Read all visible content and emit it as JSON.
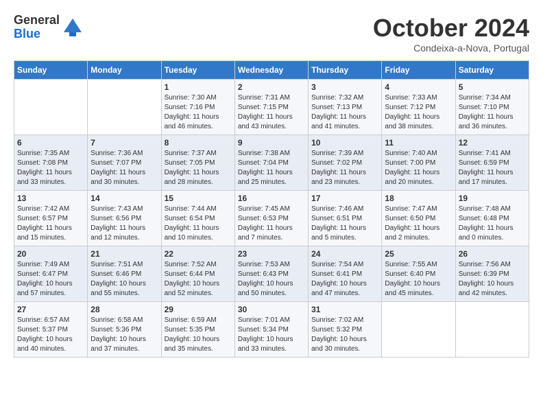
{
  "logo": {
    "general": "General",
    "blue": "Blue"
  },
  "title": "October 2024",
  "subtitle": "Condeixa-a-Nova, Portugal",
  "days_of_week": [
    "Sunday",
    "Monday",
    "Tuesday",
    "Wednesday",
    "Thursday",
    "Friday",
    "Saturday"
  ],
  "weeks": [
    [
      {
        "day": "",
        "info": ""
      },
      {
        "day": "",
        "info": ""
      },
      {
        "day": "1",
        "info": "Sunrise: 7:30 AM\nSunset: 7:16 PM\nDaylight: 11 hours and 46 minutes."
      },
      {
        "day": "2",
        "info": "Sunrise: 7:31 AM\nSunset: 7:15 PM\nDaylight: 11 hours and 43 minutes."
      },
      {
        "day": "3",
        "info": "Sunrise: 7:32 AM\nSunset: 7:13 PM\nDaylight: 11 hours and 41 minutes."
      },
      {
        "day": "4",
        "info": "Sunrise: 7:33 AM\nSunset: 7:12 PM\nDaylight: 11 hours and 38 minutes."
      },
      {
        "day": "5",
        "info": "Sunrise: 7:34 AM\nSunset: 7:10 PM\nDaylight: 11 hours and 36 minutes."
      }
    ],
    [
      {
        "day": "6",
        "info": "Sunrise: 7:35 AM\nSunset: 7:08 PM\nDaylight: 11 hours and 33 minutes."
      },
      {
        "day": "7",
        "info": "Sunrise: 7:36 AM\nSunset: 7:07 PM\nDaylight: 11 hours and 30 minutes."
      },
      {
        "day": "8",
        "info": "Sunrise: 7:37 AM\nSunset: 7:05 PM\nDaylight: 11 hours and 28 minutes."
      },
      {
        "day": "9",
        "info": "Sunrise: 7:38 AM\nSunset: 7:04 PM\nDaylight: 11 hours and 25 minutes."
      },
      {
        "day": "10",
        "info": "Sunrise: 7:39 AM\nSunset: 7:02 PM\nDaylight: 11 hours and 23 minutes."
      },
      {
        "day": "11",
        "info": "Sunrise: 7:40 AM\nSunset: 7:00 PM\nDaylight: 11 hours and 20 minutes."
      },
      {
        "day": "12",
        "info": "Sunrise: 7:41 AM\nSunset: 6:59 PM\nDaylight: 11 hours and 17 minutes."
      }
    ],
    [
      {
        "day": "13",
        "info": "Sunrise: 7:42 AM\nSunset: 6:57 PM\nDaylight: 11 hours and 15 minutes."
      },
      {
        "day": "14",
        "info": "Sunrise: 7:43 AM\nSunset: 6:56 PM\nDaylight: 11 hours and 12 minutes."
      },
      {
        "day": "15",
        "info": "Sunrise: 7:44 AM\nSunset: 6:54 PM\nDaylight: 11 hours and 10 minutes."
      },
      {
        "day": "16",
        "info": "Sunrise: 7:45 AM\nSunset: 6:53 PM\nDaylight: 11 hours and 7 minutes."
      },
      {
        "day": "17",
        "info": "Sunrise: 7:46 AM\nSunset: 6:51 PM\nDaylight: 11 hours and 5 minutes."
      },
      {
        "day": "18",
        "info": "Sunrise: 7:47 AM\nSunset: 6:50 PM\nDaylight: 11 hours and 2 minutes."
      },
      {
        "day": "19",
        "info": "Sunrise: 7:48 AM\nSunset: 6:48 PM\nDaylight: 11 hours and 0 minutes."
      }
    ],
    [
      {
        "day": "20",
        "info": "Sunrise: 7:49 AM\nSunset: 6:47 PM\nDaylight: 10 hours and 57 minutes."
      },
      {
        "day": "21",
        "info": "Sunrise: 7:51 AM\nSunset: 6:46 PM\nDaylight: 10 hours and 55 minutes."
      },
      {
        "day": "22",
        "info": "Sunrise: 7:52 AM\nSunset: 6:44 PM\nDaylight: 10 hours and 52 minutes."
      },
      {
        "day": "23",
        "info": "Sunrise: 7:53 AM\nSunset: 6:43 PM\nDaylight: 10 hours and 50 minutes."
      },
      {
        "day": "24",
        "info": "Sunrise: 7:54 AM\nSunset: 6:41 PM\nDaylight: 10 hours and 47 minutes."
      },
      {
        "day": "25",
        "info": "Sunrise: 7:55 AM\nSunset: 6:40 PM\nDaylight: 10 hours and 45 minutes."
      },
      {
        "day": "26",
        "info": "Sunrise: 7:56 AM\nSunset: 6:39 PM\nDaylight: 10 hours and 42 minutes."
      }
    ],
    [
      {
        "day": "27",
        "info": "Sunrise: 6:57 AM\nSunset: 5:37 PM\nDaylight: 10 hours and 40 minutes."
      },
      {
        "day": "28",
        "info": "Sunrise: 6:58 AM\nSunset: 5:36 PM\nDaylight: 10 hours and 37 minutes."
      },
      {
        "day": "29",
        "info": "Sunrise: 6:59 AM\nSunset: 5:35 PM\nDaylight: 10 hours and 35 minutes."
      },
      {
        "day": "30",
        "info": "Sunrise: 7:01 AM\nSunset: 5:34 PM\nDaylight: 10 hours and 33 minutes."
      },
      {
        "day": "31",
        "info": "Sunrise: 7:02 AM\nSunset: 5:32 PM\nDaylight: 10 hours and 30 minutes."
      },
      {
        "day": "",
        "info": ""
      },
      {
        "day": "",
        "info": ""
      }
    ]
  ]
}
